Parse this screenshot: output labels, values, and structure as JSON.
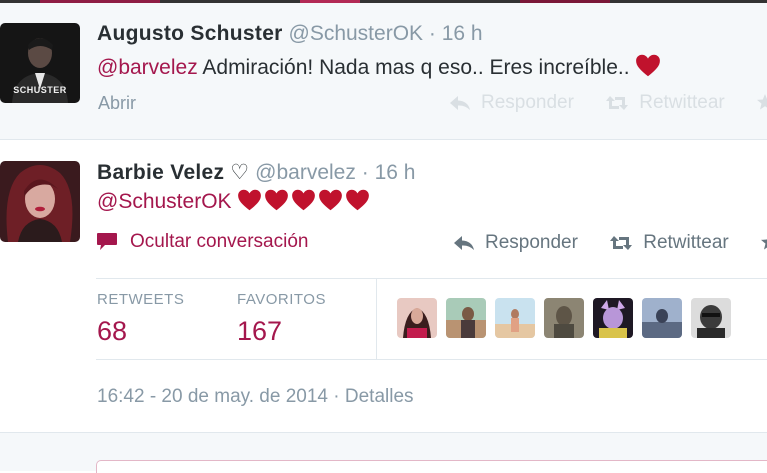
{
  "tweet1": {
    "author_name": "Augusto Schuster",
    "screen_name": "@SchusterOK",
    "separator": "·",
    "time": "16 h",
    "mention": "@barvelez",
    "text": " Admiración! Nada mas q eso.. Eres increíble.. ",
    "avatar_text": "SCHUSTER",
    "open_label": "Abrir",
    "reply_label": "Responder",
    "retweet_label": "Retwittear"
  },
  "tweet2": {
    "author_name": "Barbie Velez",
    "name_symbol": "♡",
    "screen_name": "@barvelez",
    "separator": "·",
    "time": "16 h",
    "mention": "@SchusterOK",
    "heart_count": 5,
    "hide_conversation_label": "Ocultar conversación",
    "reply_label": "Responder",
    "retweet_label": "Retwittear",
    "stats": {
      "retweets_label": "RETWEETS",
      "retweets_value": "68",
      "favorites_label": "FAVORITOS",
      "favorites_value": "167"
    },
    "datetime": "16:42 - 20 de may. de 2014",
    "detail_separator": "·",
    "details_label": "Detalles"
  },
  "colors": {
    "accent": "#a4174d",
    "heart": "#c0122d",
    "muted": "#8899a6",
    "text": "#292f33",
    "bg_alt": "#f5f8fa"
  },
  "icons": {
    "heart": "heart-icon",
    "reply": "reply-icon",
    "retweet": "retweet-icon",
    "favorite": "star-icon",
    "conversation": "speech-bubble-icon"
  }
}
